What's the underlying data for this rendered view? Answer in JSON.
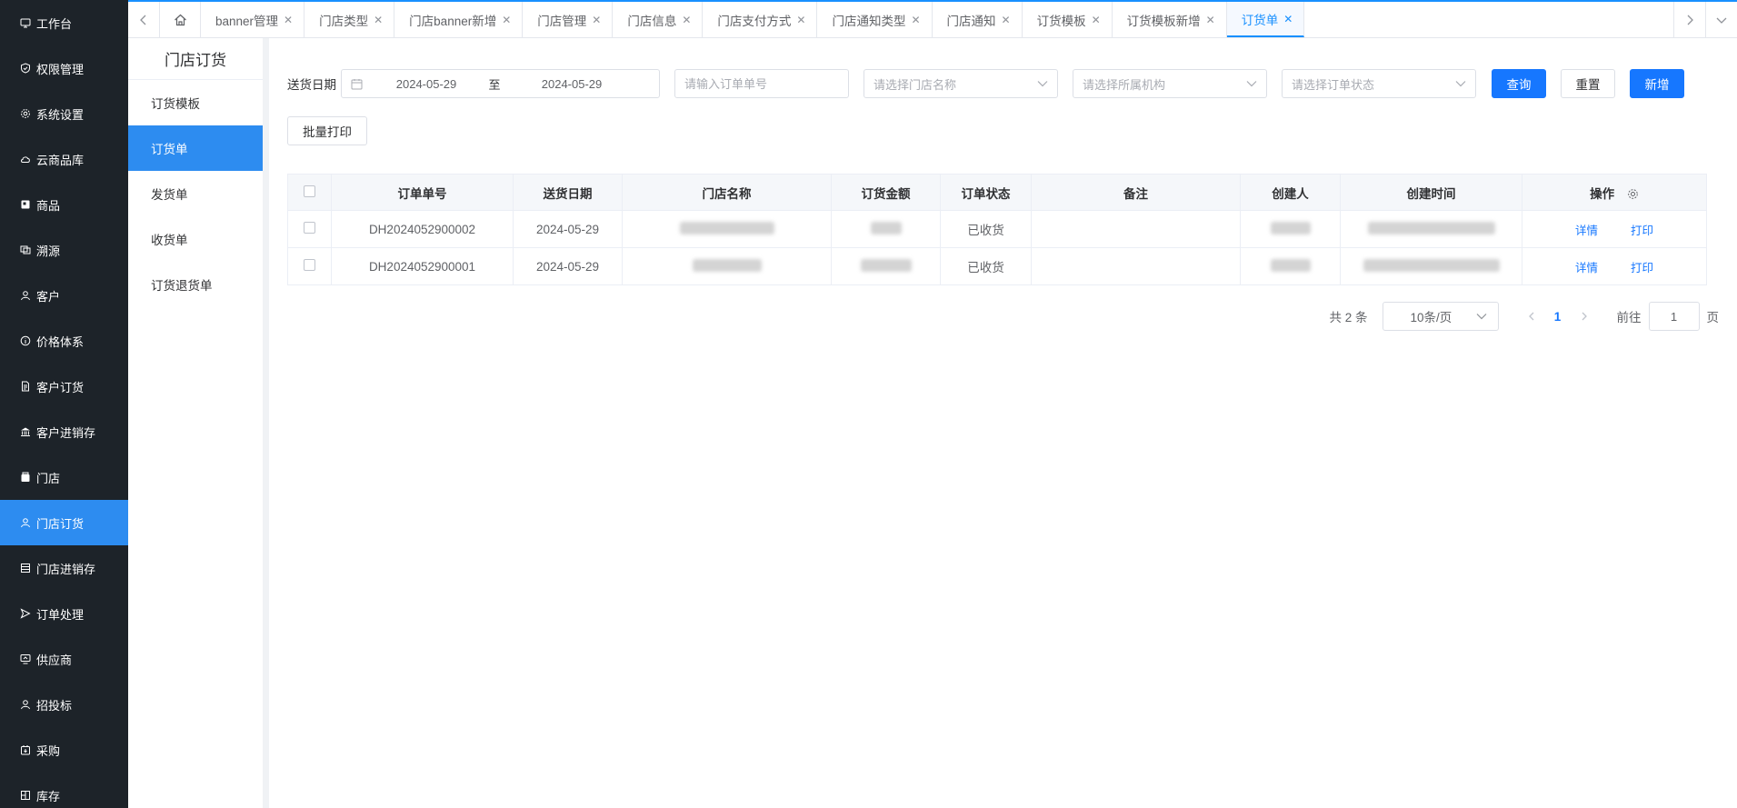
{
  "sidebar": {
    "items": [
      {
        "label": "工作台",
        "icon": "monitor-icon",
        "active": false
      },
      {
        "label": "权限管理",
        "icon": "shield-icon",
        "active": false
      },
      {
        "label": "系统设置",
        "icon": "gear-icon",
        "active": false
      },
      {
        "label": "云商品库",
        "icon": "cloud-icon",
        "active": false
      },
      {
        "label": "商品",
        "icon": "goods-icon",
        "active": false
      },
      {
        "label": "溯源",
        "icon": "trace-icon",
        "active": false
      },
      {
        "label": "客户",
        "icon": "user-icon",
        "active": false
      },
      {
        "label": "价格体系",
        "icon": "info-icon",
        "active": false
      },
      {
        "label": "客户订货",
        "icon": "document-icon",
        "active": false
      },
      {
        "label": "客户进销存",
        "icon": "bank-icon",
        "active": false
      },
      {
        "label": "门店",
        "icon": "store-icon",
        "active": false
      },
      {
        "label": "门店订货",
        "icon": "user-icon",
        "active": true
      },
      {
        "label": "门店进销存",
        "icon": "list-icon",
        "active": false
      },
      {
        "label": "订单处理",
        "icon": "send-icon",
        "active": false
      },
      {
        "label": "供应商",
        "icon": "screen-icon",
        "active": false
      },
      {
        "label": "招投标",
        "icon": "user-icon",
        "active": false
      },
      {
        "label": "采购",
        "icon": "purchase-icon",
        "active": false
      },
      {
        "label": "库存",
        "icon": "grid-icon",
        "active": false
      }
    ]
  },
  "tabs": [
    {
      "label": "banner管理",
      "active": false
    },
    {
      "label": "门店类型",
      "active": false
    },
    {
      "label": "门店banner新增",
      "active": false
    },
    {
      "label": "门店管理",
      "active": false
    },
    {
      "label": "门店信息",
      "active": false
    },
    {
      "label": "门店支付方式",
      "active": false
    },
    {
      "label": "门店通知类型",
      "active": false
    },
    {
      "label": "门店通知",
      "active": false
    },
    {
      "label": "订货模板",
      "active": false
    },
    {
      "label": "订货模板新增",
      "active": false
    },
    {
      "label": "订货单",
      "active": true
    }
  ],
  "tab_close": "✕",
  "submenu": {
    "title": "门店订货",
    "items": [
      {
        "label": "订货模板",
        "active": false
      },
      {
        "label": "订货单",
        "active": true
      },
      {
        "label": "发货单",
        "active": false
      },
      {
        "label": "收货单",
        "active": false
      },
      {
        "label": "订货退货单",
        "active": false
      }
    ]
  },
  "filters": {
    "date_label": "送货日期",
    "date_start": "2024-05-29",
    "date_sep": "至",
    "date_end": "2024-05-29",
    "order_no_placeholder": "请输入订单单号",
    "store_placeholder": "请选择门店名称",
    "org_placeholder": "请选择所属机构",
    "status_placeholder": "请选择订单状态",
    "query_label": "查询",
    "reset_label": "重置",
    "add_label": "新增",
    "batch_print_label": "批量打印"
  },
  "table": {
    "columns": [
      "订单单号",
      "送货日期",
      "门店名称",
      "订货金额",
      "订单状态",
      "备注",
      "创建人",
      "创建时间",
      "操作"
    ],
    "rows": [
      {
        "order_no": "DH2024052900002",
        "date": "2024-05-29",
        "status": "已收货",
        "remark": "",
        "detail": "详情",
        "print": "打印"
      },
      {
        "order_no": "DH2024052900001",
        "date": "2024-05-29",
        "status": "已收货",
        "remark": "",
        "detail": "详情",
        "print": "打印"
      }
    ]
  },
  "pagination": {
    "total": "共 2 条",
    "page_size": "10条/页",
    "current": "1",
    "goto_label": "前往",
    "goto_value": "1",
    "unit": "页"
  },
  "colors": {
    "accent": "#1677ff",
    "sidebar_bg": "#1d2329",
    "active_bg": "#2d8cf0"
  }
}
